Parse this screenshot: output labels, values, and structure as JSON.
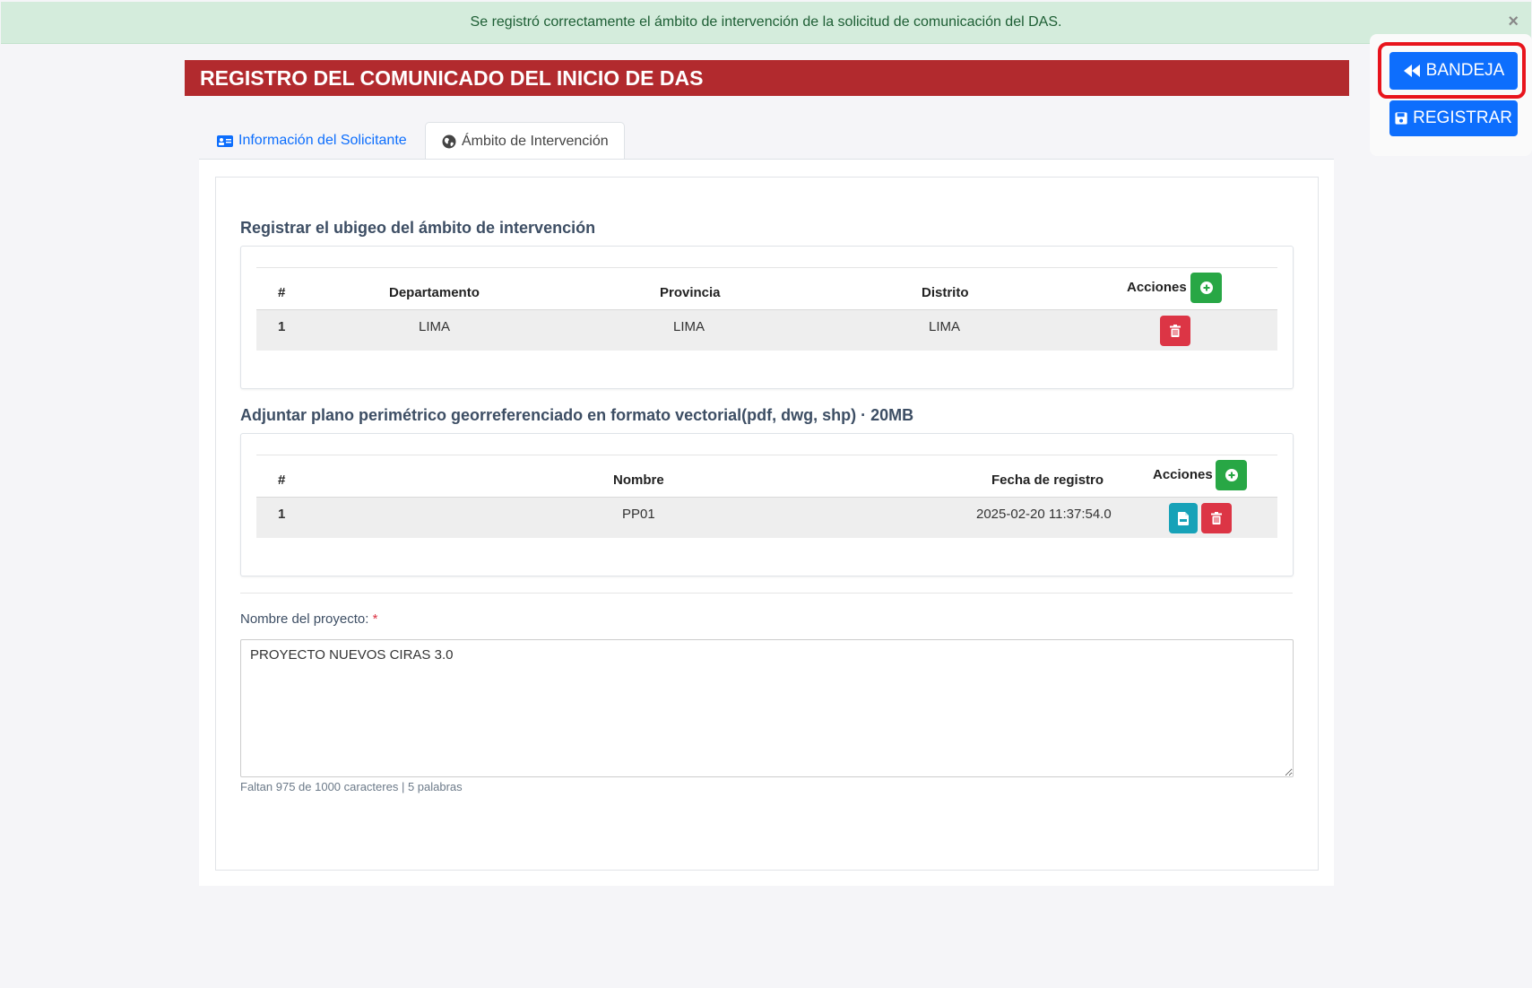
{
  "alert": {
    "message": "Se registró correctamente el ámbito de intervención de la solicitud de comunicación del DAS.",
    "close": "×"
  },
  "actions": {
    "bandeja_label": "BANDEJA",
    "registrar_label": "REGISTRAR"
  },
  "header": {
    "title": "REGISTRO DEL COMUNICADO DEL INICIO DE DAS"
  },
  "tabs": [
    {
      "label": "Información del Solicitante",
      "active": false
    },
    {
      "label": "Ámbito de Intervención",
      "active": true
    }
  ],
  "ubigeo": {
    "title": "Registrar el ubigeo del ámbito de intervención",
    "columns": [
      "#",
      "Departamento",
      "Provincia",
      "Distrito",
      "Acciones"
    ],
    "rows": [
      {
        "num": "1",
        "departamento": "LIMA",
        "provincia": "LIMA",
        "distrito": "LIMA"
      }
    ]
  },
  "plano": {
    "title": "Adjuntar plano perimétrico georreferenciado en formato vectorial(pdf, dwg, shp) · 20MB",
    "columns": [
      "#",
      "Nombre",
      "Fecha de registro",
      "Acciones"
    ],
    "rows": [
      {
        "num": "1",
        "nombre": "PP01",
        "fecha": "2025-02-20 11:37:54.0"
      }
    ]
  },
  "project": {
    "label": "Nombre del proyecto:",
    "required_mark": "*",
    "value": "PROYECTO NUEVOS CIRAS 3.0",
    "counter": "Faltan 975 de 1000 caracteres | 5 palabras"
  },
  "colors": {
    "header_red": "#b22a2e",
    "primary_blue": "#0d6efd",
    "success_green": "#28a745",
    "danger_red": "#dc3545",
    "info_cyan": "#17a2b8",
    "alert_bg": "#d4ecdc"
  }
}
